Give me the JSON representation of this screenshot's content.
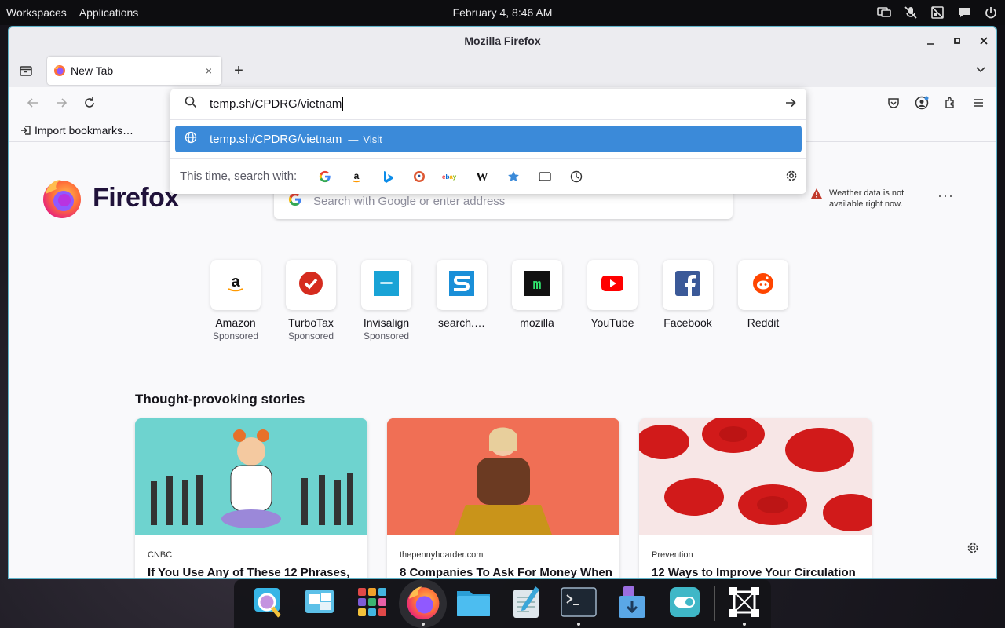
{
  "system_bar": {
    "workspaces": "Workspaces",
    "applications": "Applications",
    "clock": "February 4, 8:46 AM",
    "tray_icons": [
      "display-icon",
      "mic-muted-icon",
      "network-disabled-icon",
      "notifications-icon",
      "power-icon"
    ]
  },
  "window": {
    "title": "Mozilla Firefox",
    "border_color": "#5fb3c9"
  },
  "tabs": [
    {
      "label": "New Tab",
      "icon": "firefox-icon",
      "close": "×"
    }
  ],
  "newtab_label": "+",
  "urlbar": {
    "value": "temp.sh/CPDRG/vietnam",
    "suggestion": {
      "text": "temp.sh/CPDRG/vietnam",
      "separator": "—",
      "action": "Visit"
    },
    "oneoff_label": "This time, search with:",
    "engines": [
      "google",
      "amazon",
      "bing",
      "duckduckgo",
      "ebay",
      "wikipedia",
      "bookmarks",
      "tabs",
      "history"
    ],
    "highlight_color": "#3b8ad9"
  },
  "bookmarks_bar": {
    "import_label": "Import bookmarks…"
  },
  "newtab": {
    "brand": "Firefox",
    "search_placeholder": "Search with Google or enter address",
    "weather_line1": "Weather data is not",
    "weather_line2": "available right now.",
    "weather_more": "···",
    "shortcuts": [
      {
        "name": "Amazon",
        "sub": "Sponsored",
        "icon": "amazon-icon"
      },
      {
        "name": "TurboTax",
        "sub": "Sponsored",
        "icon": "turbotax-icon"
      },
      {
        "name": "Invisalign",
        "sub": "Sponsored",
        "icon": "invisalign-icon"
      },
      {
        "name": "search.…",
        "sub": "",
        "icon": "search-site-icon"
      },
      {
        "name": "mozilla",
        "sub": "",
        "icon": "mozilla-icon"
      },
      {
        "name": "YouTube",
        "sub": "",
        "icon": "youtube-icon"
      },
      {
        "name": "Facebook",
        "sub": "",
        "icon": "facebook-icon"
      },
      {
        "name": "Reddit",
        "sub": "",
        "icon": "reddit-icon"
      }
    ],
    "stories_title": "Thought-provoking stories",
    "stories": [
      {
        "source": "CNBC",
        "title": "If You Use Any of These 12 Phrases,"
      },
      {
        "source": "thepennyhoarder.com",
        "title": "8 Companies To Ask For Money When"
      },
      {
        "source": "Prevention",
        "title": "12 Ways to Improve Your Circulation"
      }
    ]
  },
  "dock": {
    "items": [
      "magnifier-icon",
      "workspaces-icon",
      "app-grid-icon",
      "firefox-icon",
      "files-icon",
      "text-editor-icon",
      "terminal-icon",
      "software-store-icon",
      "settings-toggle-icon",
      "screenshot-icon"
    ]
  }
}
